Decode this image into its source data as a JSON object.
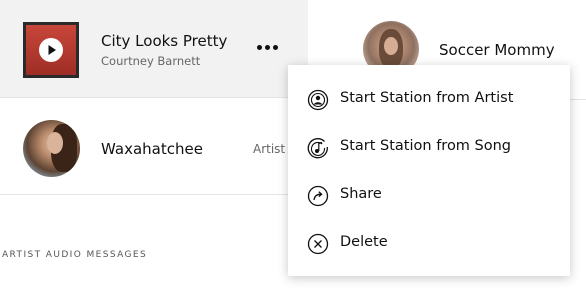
{
  "left": {
    "song": {
      "title": "City Looks Pretty",
      "artist": "Courtney Barnett",
      "art_color": "#b83a30",
      "play_icon": "play-icon",
      "more_icon": "more-horizontal-icon"
    },
    "artist_row": {
      "name": "Waxahatchee",
      "type": "Artist"
    },
    "section_label": "ARTIST AUDIO MESSAGES"
  },
  "right": {
    "artist_row": {
      "name": "Soccer Mommy"
    }
  },
  "context_menu": {
    "items": [
      {
        "label": "Start Station from Artist",
        "icon": "artist-station-icon"
      },
      {
        "label": "Start Station from Song",
        "icon": "song-station-icon"
      },
      {
        "label": "Share",
        "icon": "share-icon"
      },
      {
        "label": "Delete",
        "icon": "delete-icon"
      }
    ]
  }
}
